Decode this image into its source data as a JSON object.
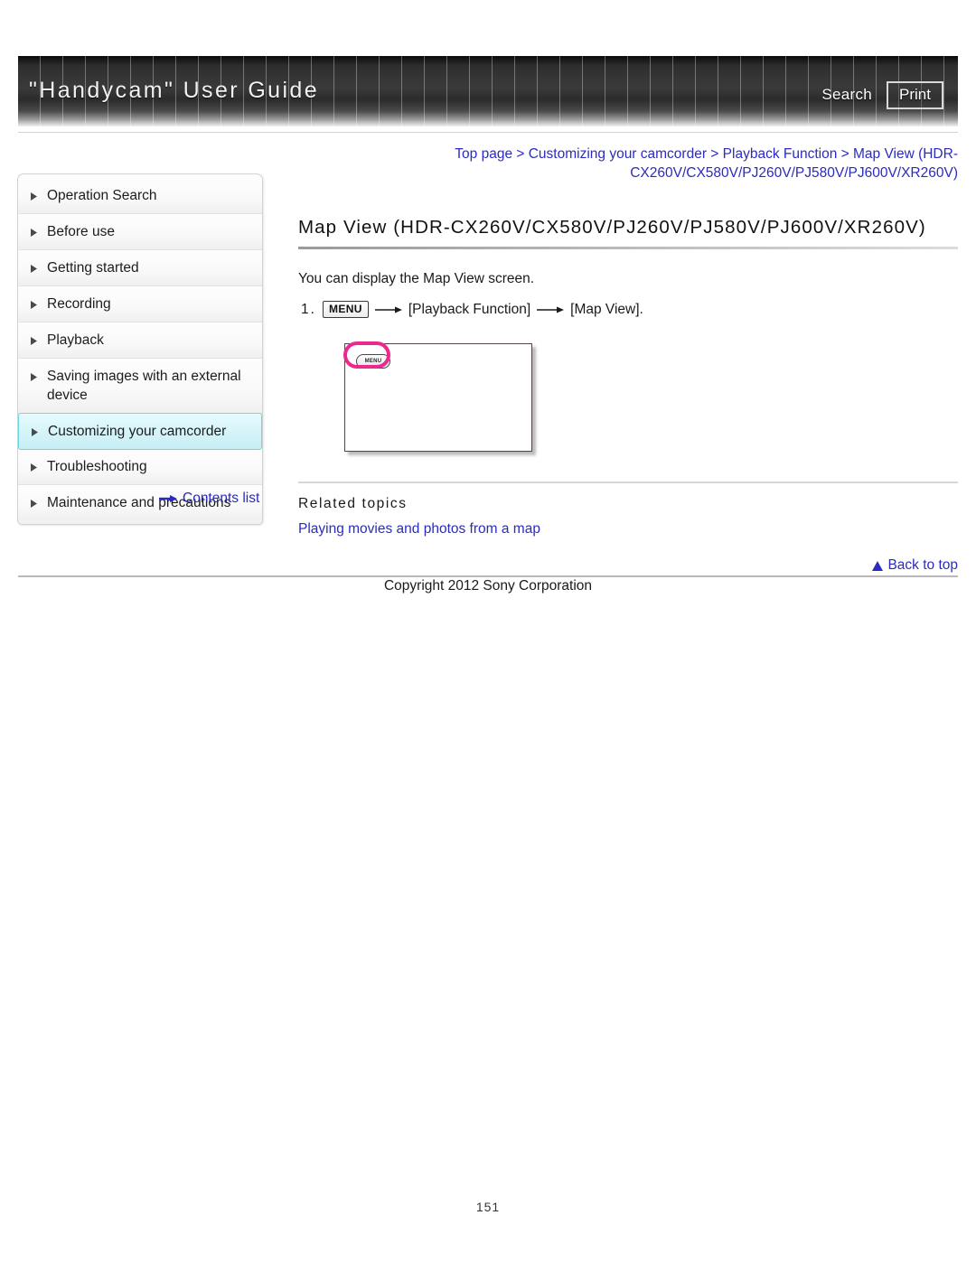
{
  "header": {
    "title": "\"Handycam\" User Guide",
    "search_label": "Search",
    "print_label": "Print"
  },
  "breadcrumb": {
    "line1_part1": "Top page",
    "sep": " > ",
    "line1_part2": "Customizing your camcorder",
    "line1_part3": "Playback Function",
    "line1_part4": "Map View (HDR-",
    "line2": "CX260V/CX580V/PJ260V/PJ580V/PJ600V/XR260V)"
  },
  "sidebar": {
    "items": [
      {
        "label": "Operation Search",
        "active": false
      },
      {
        "label": "Before use",
        "active": false
      },
      {
        "label": "Getting started",
        "active": false
      },
      {
        "label": "Recording",
        "active": false
      },
      {
        "label": "Playback",
        "active": false
      },
      {
        "label": "Saving images with an external device",
        "active": false
      },
      {
        "label": "Customizing your camcorder",
        "active": true
      },
      {
        "label": "Troubleshooting",
        "active": false
      },
      {
        "label": "Maintenance and precautions",
        "active": false
      }
    ],
    "contents_list_label": "Contents list"
  },
  "main": {
    "page_title": "Map View (HDR-CX260V/CX580V/PJ260V/PJ580V/PJ600V/XR260V)",
    "intro": "You can display the Map View screen.",
    "step": {
      "number": "1.",
      "menu_chip": "MENU",
      "item1": "[Playback Function]",
      "item2": "[Map View]."
    },
    "figure": {
      "menu_button_label": "MENU",
      "highlight_color": "#ec2a8e"
    },
    "related_topics_title": "Related topics",
    "related_links": [
      "Playing movies and photos from a map"
    ]
  },
  "footer": {
    "back_to_top_label": "Back to top",
    "copyright": "Copyright 2012 Sony Corporation",
    "page_number": "151"
  },
  "colors": {
    "link": "#2b2bc0",
    "highlight_nav": "#c6eff6",
    "highlight_ring": "#ec2a8e"
  }
}
